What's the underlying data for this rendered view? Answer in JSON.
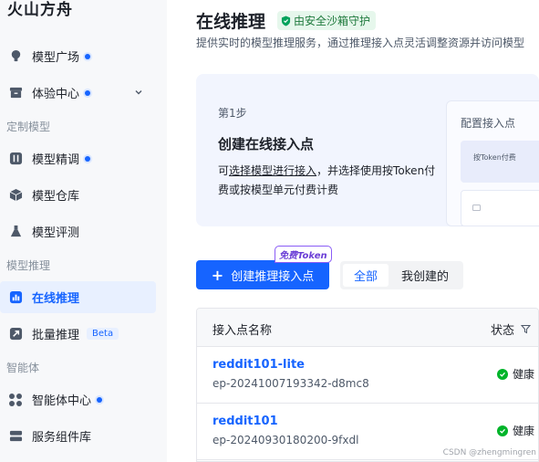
{
  "brand": "火山方舟",
  "sidebar": {
    "items": [
      {
        "label": "模型广场"
      },
      {
        "label": "体验中心"
      },
      {
        "label": "模型精调"
      },
      {
        "label": "模型仓库"
      },
      {
        "label": "模型评测"
      },
      {
        "label": "在线推理"
      },
      {
        "label": "批量推理",
        "badge": "Beta"
      },
      {
        "label": "智能体中心"
      },
      {
        "label": "服务组件库"
      }
    ],
    "sections": [
      "定制模型",
      "模型推理",
      "智能体"
    ]
  },
  "page": {
    "title": "在线推理",
    "sandbox_badge": "由安全沙箱守护",
    "subtitle": "提供实时的模型推理服务，通过推理接入点灵活调整资源并访问模型"
  },
  "guide": {
    "step": "第1步",
    "title": "创建在线接入点",
    "desc_prefix": "可",
    "desc_link": "选择模型进行接入",
    "desc_suffix": "，并选择使用按Token付费或按模型单元付费计费",
    "preview_title": "配置接入点",
    "preview_option": "按Token付费"
  },
  "actions": {
    "create_label": "创建推理接入点",
    "free_tag": "免费Token",
    "filter_all": "全部",
    "filter_mine": "我创建的"
  },
  "table": {
    "col_name": "接入点名称",
    "col_status": "状态",
    "rows": [
      {
        "name": "reddit101-lite",
        "id": "ep-20241007193342-d8mc8",
        "status": "健康"
      },
      {
        "name": "reddit101",
        "id": "ep-20240930180200-9fxdl",
        "status": "健康"
      }
    ]
  },
  "watermark": "CSDN @zhengmingren",
  "colors": {
    "accent": "#1664ff",
    "healthy": "#00b42a",
    "sandbox": "#1f7a3d"
  }
}
